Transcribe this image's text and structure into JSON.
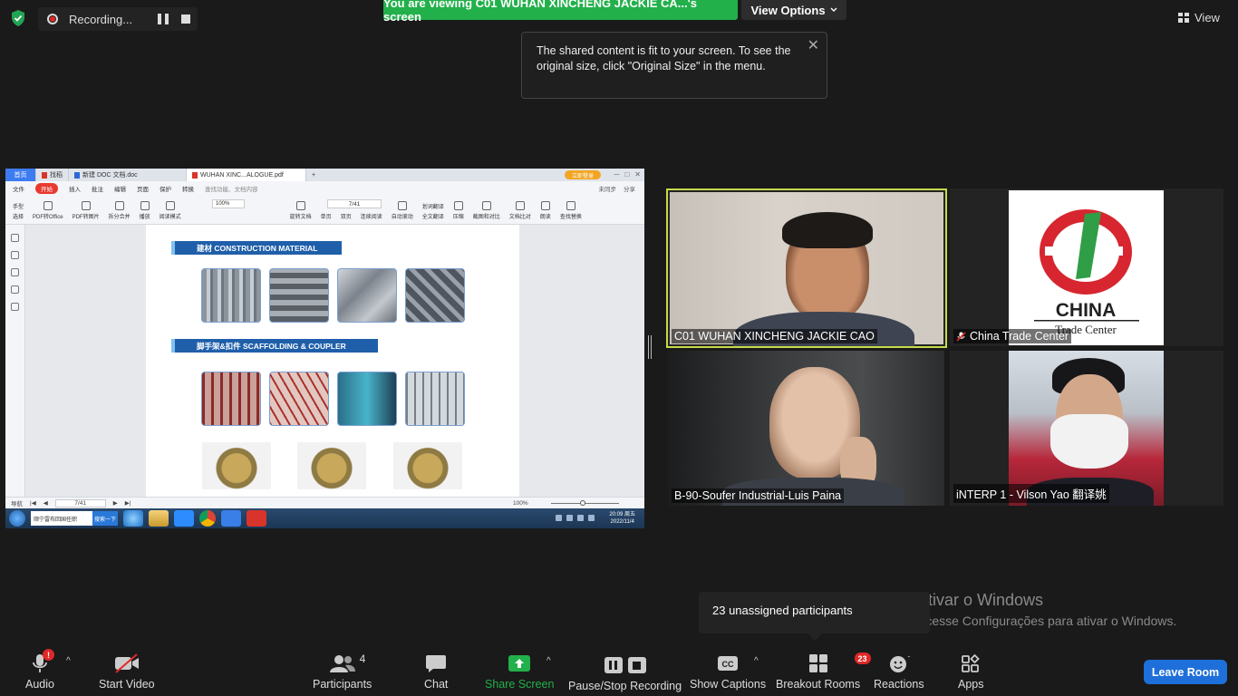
{
  "top": {
    "recording_label": "Recording...",
    "viewing_banner": "You are viewing C01 WUHAN  XINCHENG  JACKIE CA...'s screen",
    "view_options": "View Options",
    "view_label": "View",
    "tooltip_text": "The shared content is fit to your screen. To see the original size, click \"Original Size\" in the menu."
  },
  "shared_screen": {
    "tabs": [
      {
        "label": "首页"
      },
      {
        "label": "找稻"
      },
      {
        "label": "新建 DOC 文档.doc"
      },
      {
        "label": "WUHAN XINC...ALOGUE.pdf"
      }
    ],
    "new_tab": "+",
    "vip_label": "立即登录",
    "menu": [
      "文件",
      "开始",
      "插入",
      "批注",
      "编辑",
      "页面",
      "保护",
      "转换"
    ],
    "search_placeholder": "查找功能、文档内容",
    "menu_right": [
      "未同步",
      "分享"
    ],
    "tools": [
      "手型",
      "选择",
      "PDF转Office",
      "PDF转图片",
      "拆分合并",
      "播放",
      "阅读模式",
      "旋转文档",
      "单页",
      "双页",
      "连续阅读",
      "自动滚动",
      "划词翻译",
      "全文翻译",
      "压缩",
      "截图和对比",
      "文档比对",
      "朗读",
      "查找替换"
    ],
    "zoom_value": "100%",
    "page_value": "7/41",
    "section1": "建材  CONSTRUCTION MATERIAL",
    "section2": "脚手架&扣件  SCAFFOLDING & COUPLER",
    "status_nav": "导航",
    "status_page": "7/41",
    "status_zoom": "100%",
    "taskbar_search": "顺宁雷布回国任职",
    "taskbar_search_btn": "搜索一下",
    "clock_time": "20:09 周五",
    "clock_date": "2022/11/4"
  },
  "participants": [
    {
      "name": "C01 WUHAN  XINCHENG  JACKIE CAO",
      "muted": false,
      "active_speaker": true
    },
    {
      "name": "China Trade Center",
      "muted": true,
      "logo_text": "CHINA",
      "logo_sub": "Trade Center"
    },
    {
      "name": "B-90-Soufer Industrial-Luis Paina",
      "muted": false
    },
    {
      "name": "iNTERP 1 - Vilson Yao 翻译姚",
      "muted": false
    }
  ],
  "watermark": {
    "title": "Ativar o Windows",
    "subtitle": "Acesse Configurações para ativar o Windows."
  },
  "unassigned_tooltip": "23 unassigned participants",
  "toolbar": {
    "audio": "Audio",
    "start_video": "Start Video",
    "participants": "Participants",
    "participants_count": "4",
    "chat": "Chat",
    "share_screen": "Share Screen",
    "pause_stop_recording": "Pause/Stop Recording",
    "show_captions": "Show Captions",
    "breakout_rooms": "Breakout Rooms",
    "breakout_count": "23",
    "reactions": "Reactions",
    "apps": "Apps",
    "leave_room": "Leave Room",
    "audio_alert": "!"
  },
  "colors": {
    "banner_green": "#22b04b",
    "leave_blue": "#1e6fd9",
    "active_speaker_border": "#c7d94a",
    "badge_red": "#e02828"
  }
}
